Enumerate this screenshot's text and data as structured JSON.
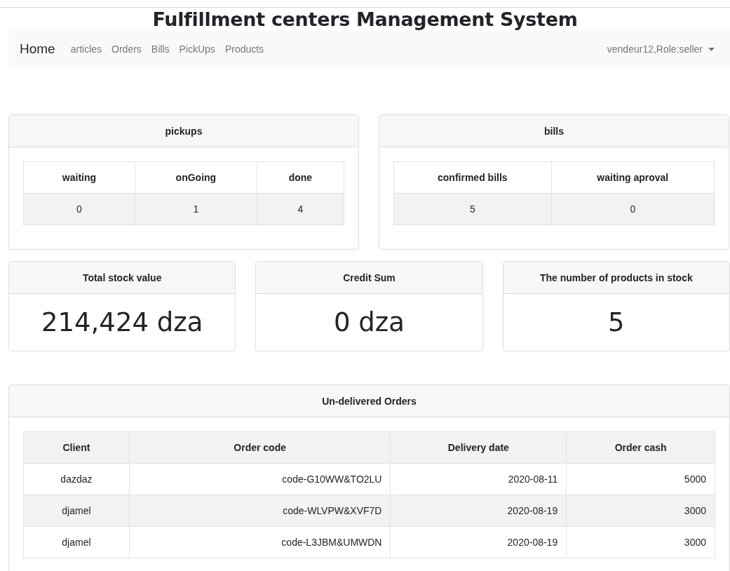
{
  "title": "Fulfillment centers Management System",
  "navbar": {
    "brand": "Home",
    "links": [
      "articles",
      "Orders",
      "Bills",
      "PickUps",
      "Products"
    ],
    "user_menu": "vendeur12,Role:seller"
  },
  "pickups": {
    "title": "pickups",
    "columns": [
      "waiting",
      "onGoing",
      "done"
    ],
    "values": [
      "0",
      "1",
      "4"
    ]
  },
  "bills": {
    "title": "bills",
    "columns": [
      "confirmed bills",
      "waiting aproval"
    ],
    "values": [
      "5",
      "0"
    ]
  },
  "stats": [
    {
      "title": "Total stock value",
      "value": "214,424 dza"
    },
    {
      "title": "Credit Sum",
      "value": "0 dza"
    },
    {
      "title": "The number of products in stock",
      "value": "5"
    }
  ],
  "orders": {
    "title": "Un-delivered Orders",
    "columns": [
      "Client",
      "Order code",
      "Delivery date",
      "Order cash"
    ],
    "rows": [
      [
        "dazdaz",
        "code-G10WW&TO2LU",
        "2020-08-11",
        "5000"
      ],
      [
        "djamel",
        "code-WLVPW&XVF7D",
        "2020-08-19",
        "3000"
      ],
      [
        "djamel",
        "code-L3JBM&UMWDN",
        "2020-08-19",
        "3000"
      ]
    ]
  }
}
